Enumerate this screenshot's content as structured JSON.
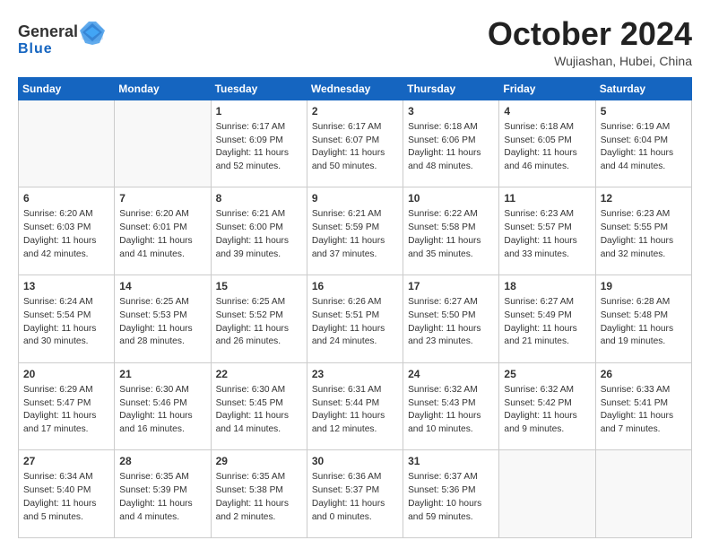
{
  "header": {
    "logo_general": "General",
    "logo_blue": "Blue",
    "month": "October 2024",
    "location": "Wujiashan, Hubei, China"
  },
  "weekdays": [
    "Sunday",
    "Monday",
    "Tuesday",
    "Wednesday",
    "Thursday",
    "Friday",
    "Saturday"
  ],
  "weeks": [
    [
      {
        "day": "",
        "info": ""
      },
      {
        "day": "",
        "info": ""
      },
      {
        "day": "1",
        "info": "Sunrise: 6:17 AM\nSunset: 6:09 PM\nDaylight: 11 hours\nand 52 minutes."
      },
      {
        "day": "2",
        "info": "Sunrise: 6:17 AM\nSunset: 6:07 PM\nDaylight: 11 hours\nand 50 minutes."
      },
      {
        "day": "3",
        "info": "Sunrise: 6:18 AM\nSunset: 6:06 PM\nDaylight: 11 hours\nand 48 minutes."
      },
      {
        "day": "4",
        "info": "Sunrise: 6:18 AM\nSunset: 6:05 PM\nDaylight: 11 hours\nand 46 minutes."
      },
      {
        "day": "5",
        "info": "Sunrise: 6:19 AM\nSunset: 6:04 PM\nDaylight: 11 hours\nand 44 minutes."
      }
    ],
    [
      {
        "day": "6",
        "info": "Sunrise: 6:20 AM\nSunset: 6:03 PM\nDaylight: 11 hours\nand 42 minutes."
      },
      {
        "day": "7",
        "info": "Sunrise: 6:20 AM\nSunset: 6:01 PM\nDaylight: 11 hours\nand 41 minutes."
      },
      {
        "day": "8",
        "info": "Sunrise: 6:21 AM\nSunset: 6:00 PM\nDaylight: 11 hours\nand 39 minutes."
      },
      {
        "day": "9",
        "info": "Sunrise: 6:21 AM\nSunset: 5:59 PM\nDaylight: 11 hours\nand 37 minutes."
      },
      {
        "day": "10",
        "info": "Sunrise: 6:22 AM\nSunset: 5:58 PM\nDaylight: 11 hours\nand 35 minutes."
      },
      {
        "day": "11",
        "info": "Sunrise: 6:23 AM\nSunset: 5:57 PM\nDaylight: 11 hours\nand 33 minutes."
      },
      {
        "day": "12",
        "info": "Sunrise: 6:23 AM\nSunset: 5:55 PM\nDaylight: 11 hours\nand 32 minutes."
      }
    ],
    [
      {
        "day": "13",
        "info": "Sunrise: 6:24 AM\nSunset: 5:54 PM\nDaylight: 11 hours\nand 30 minutes."
      },
      {
        "day": "14",
        "info": "Sunrise: 6:25 AM\nSunset: 5:53 PM\nDaylight: 11 hours\nand 28 minutes."
      },
      {
        "day": "15",
        "info": "Sunrise: 6:25 AM\nSunset: 5:52 PM\nDaylight: 11 hours\nand 26 minutes."
      },
      {
        "day": "16",
        "info": "Sunrise: 6:26 AM\nSunset: 5:51 PM\nDaylight: 11 hours\nand 24 minutes."
      },
      {
        "day": "17",
        "info": "Sunrise: 6:27 AM\nSunset: 5:50 PM\nDaylight: 11 hours\nand 23 minutes."
      },
      {
        "day": "18",
        "info": "Sunrise: 6:27 AM\nSunset: 5:49 PM\nDaylight: 11 hours\nand 21 minutes."
      },
      {
        "day": "19",
        "info": "Sunrise: 6:28 AM\nSunset: 5:48 PM\nDaylight: 11 hours\nand 19 minutes."
      }
    ],
    [
      {
        "day": "20",
        "info": "Sunrise: 6:29 AM\nSunset: 5:47 PM\nDaylight: 11 hours\nand 17 minutes."
      },
      {
        "day": "21",
        "info": "Sunrise: 6:30 AM\nSunset: 5:46 PM\nDaylight: 11 hours\nand 16 minutes."
      },
      {
        "day": "22",
        "info": "Sunrise: 6:30 AM\nSunset: 5:45 PM\nDaylight: 11 hours\nand 14 minutes."
      },
      {
        "day": "23",
        "info": "Sunrise: 6:31 AM\nSunset: 5:44 PM\nDaylight: 11 hours\nand 12 minutes."
      },
      {
        "day": "24",
        "info": "Sunrise: 6:32 AM\nSunset: 5:43 PM\nDaylight: 11 hours\nand 10 minutes."
      },
      {
        "day": "25",
        "info": "Sunrise: 6:32 AM\nSunset: 5:42 PM\nDaylight: 11 hours\nand 9 minutes."
      },
      {
        "day": "26",
        "info": "Sunrise: 6:33 AM\nSunset: 5:41 PM\nDaylight: 11 hours\nand 7 minutes."
      }
    ],
    [
      {
        "day": "27",
        "info": "Sunrise: 6:34 AM\nSunset: 5:40 PM\nDaylight: 11 hours\nand 5 minutes."
      },
      {
        "day": "28",
        "info": "Sunrise: 6:35 AM\nSunset: 5:39 PM\nDaylight: 11 hours\nand 4 minutes."
      },
      {
        "day": "29",
        "info": "Sunrise: 6:35 AM\nSunset: 5:38 PM\nDaylight: 11 hours\nand 2 minutes."
      },
      {
        "day": "30",
        "info": "Sunrise: 6:36 AM\nSunset: 5:37 PM\nDaylight: 11 hours\nand 0 minutes."
      },
      {
        "day": "31",
        "info": "Sunrise: 6:37 AM\nSunset: 5:36 PM\nDaylight: 10 hours\nand 59 minutes."
      },
      {
        "day": "",
        "info": ""
      },
      {
        "day": "",
        "info": ""
      }
    ]
  ]
}
